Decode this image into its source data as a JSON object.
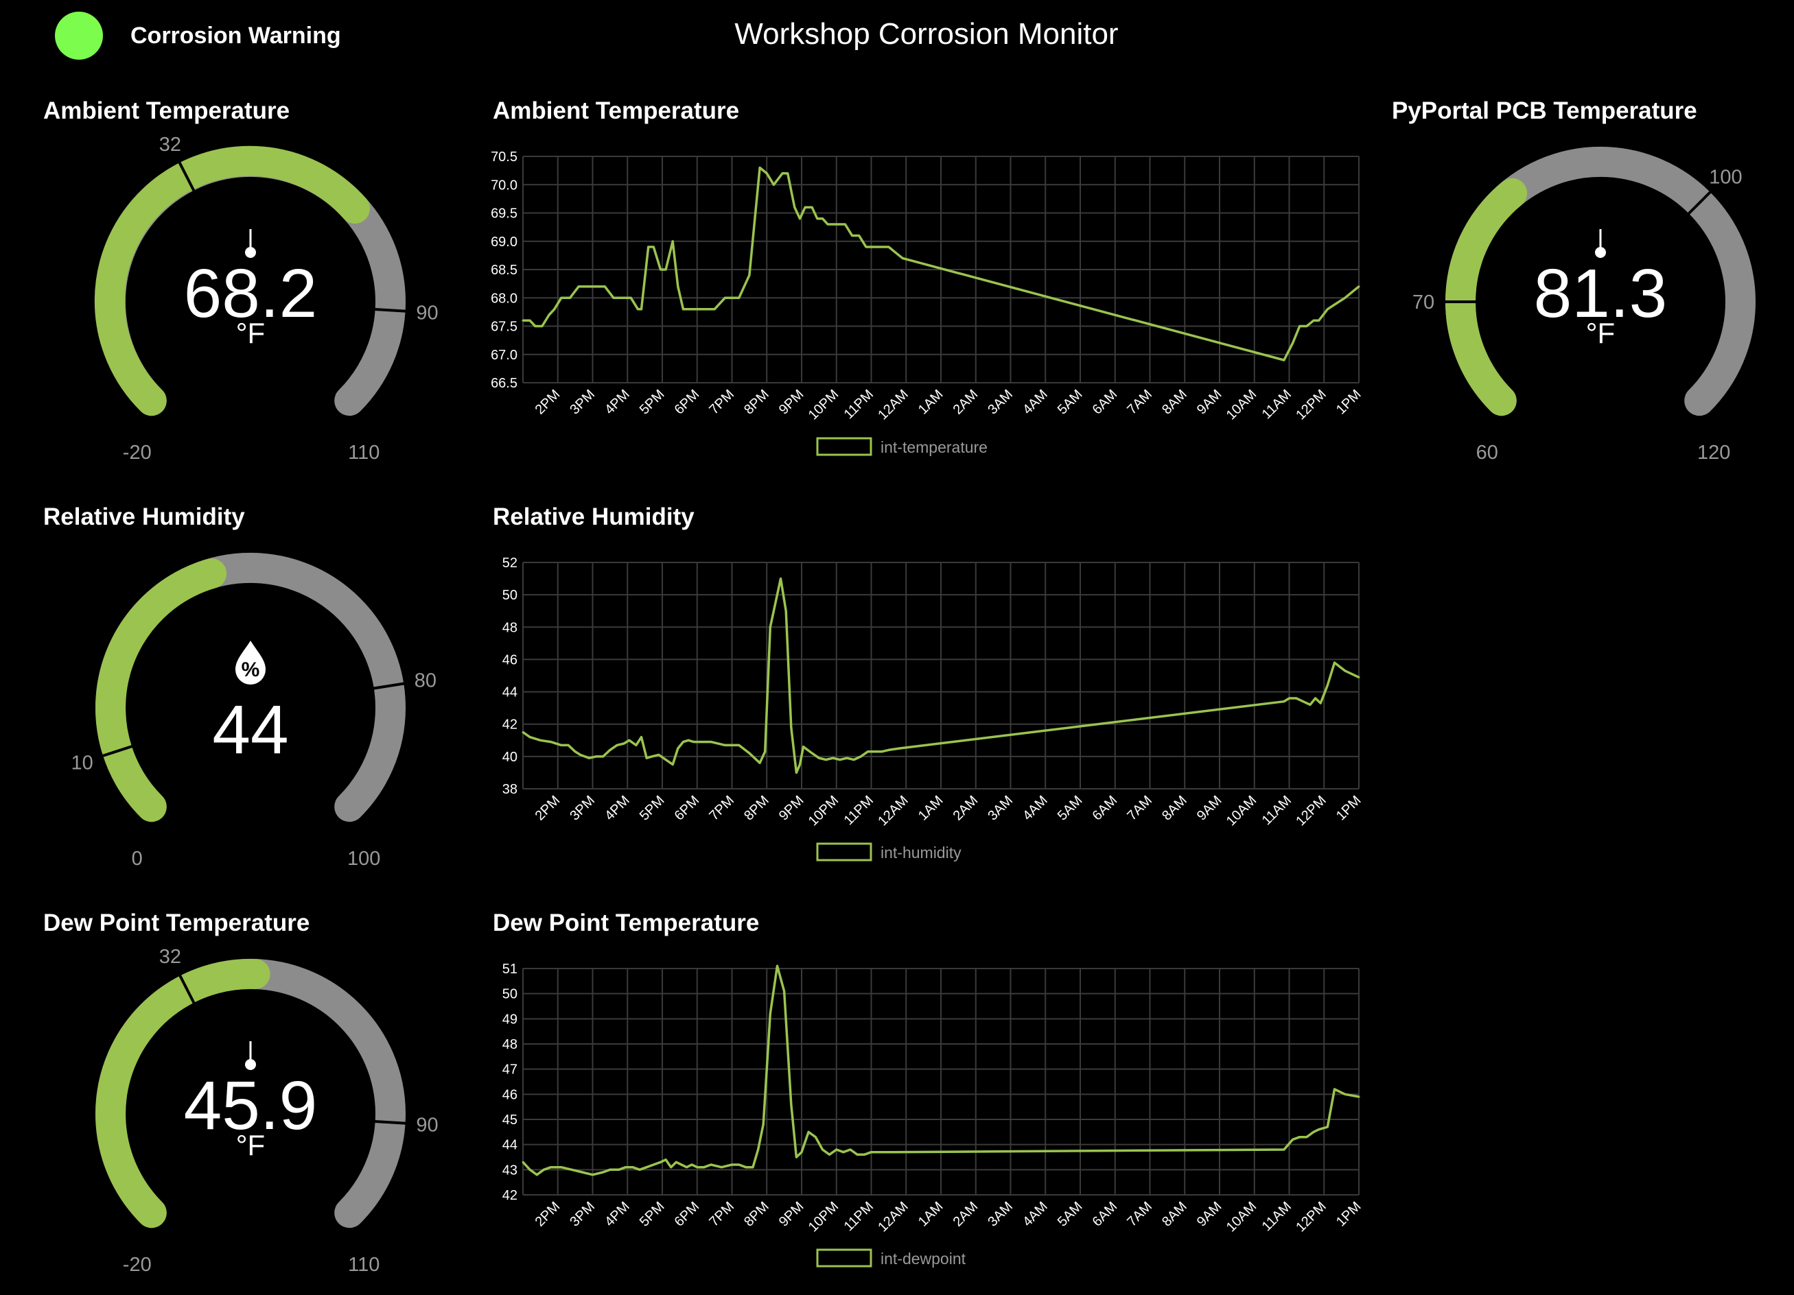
{
  "header": {
    "title": "Workshop Corrosion Monitor",
    "status_label": "Corrosion Warning",
    "status_color": "#7cfc4c"
  },
  "colors": {
    "accent": "#9bc34f",
    "track": "#8c8c8c",
    "grid": "#3a3a3a",
    "background": "#000000"
  },
  "gauges": [
    {
      "id": "ambient",
      "title": "Ambient Temperature",
      "value": "68.2",
      "unit": "°F",
      "icon": "thermometer-icon",
      "min": -20,
      "max": 110,
      "min_label": "-20",
      "max_label": "110",
      "thresholds": [
        {
          "value": 32,
          "label": "32"
        },
        {
          "value": 90,
          "label": "90"
        }
      ]
    },
    {
      "id": "pcb",
      "title": "PyPortal PCB Temperature",
      "value": "81.3",
      "unit": "°F",
      "icon": "thermometer-icon",
      "min": 60,
      "max": 120,
      "min_label": "60",
      "max_label": "120",
      "thresholds": [
        {
          "value": 70,
          "label": "70"
        },
        {
          "value": 100,
          "label": "100"
        }
      ]
    },
    {
      "id": "humidity",
      "title": "Relative Humidity",
      "value": "44",
      "unit": "",
      "icon": "humidity-drop-icon",
      "min": 0,
      "max": 100,
      "min_label": "0",
      "max_label": "100",
      "thresholds": [
        {
          "value": 10,
          "label": "10"
        },
        {
          "value": 80,
          "label": "80"
        }
      ]
    },
    {
      "id": "dewpoint",
      "title": "Dew Point Temperature",
      "value": "45.9",
      "unit": "°F",
      "icon": "thermometer-icon",
      "min": -20,
      "max": 110,
      "min_label": "-20",
      "max_label": "110",
      "thresholds": [
        {
          "value": 32,
          "label": "32"
        },
        {
          "value": 90,
          "label": "90"
        }
      ]
    }
  ],
  "charts": [
    {
      "title": "Ambient Temperature"
    },
    {
      "title": "Relative Humidity"
    },
    {
      "title": "Dew Point Temperature"
    }
  ],
  "chart_data": [
    {
      "type": "line",
      "title": "Ambient Temperature",
      "xlabel": "",
      "ylabel": "",
      "x_ticks": [
        "2PM",
        "3PM",
        "4PM",
        "5PM",
        "6PM",
        "7PM",
        "8PM",
        "9PM",
        "10PM",
        "11PM",
        "12AM",
        "1AM",
        "2AM",
        "3AM",
        "4AM",
        "5AM",
        "6AM",
        "7AM",
        "8AM",
        "9AM",
        "10AM",
        "11AM",
        "12PM",
        "1PM"
      ],
      "y_ticks": [
        "70.5",
        "70.0",
        "69.5",
        "69.0",
        "68.5",
        "68.0",
        "67.5",
        "67.0",
        "66.5"
      ],
      "ylim": [
        66.5,
        70.5
      ],
      "xlim_hours": [
        13,
        37
      ],
      "grid": true,
      "legend_position": "bottom",
      "series": [
        {
          "name": "int-temperature",
          "color": "#9bc34f",
          "x": [
            13.0,
            13.2,
            13.35,
            13.55,
            13.75,
            13.9,
            14.1,
            14.35,
            14.6,
            14.85,
            15.1,
            15.35,
            15.6,
            15.85,
            16.1,
            16.3,
            16.4,
            16.6,
            16.75,
            16.85,
            16.95,
            17.1,
            17.3,
            17.45,
            17.6,
            17.75,
            17.9,
            18.2,
            18.5,
            18.8,
            19.2,
            19.5,
            19.8,
            20.0,
            20.2,
            20.45,
            20.6,
            20.8,
            20.95,
            21.1,
            21.3,
            21.45,
            21.6,
            21.75,
            21.9,
            22.05,
            22.25,
            22.45,
            22.65,
            22.85,
            23.05,
            23.2,
            23.35,
            23.5,
            23.7,
            23.9,
            34.85,
            35.1,
            35.3,
            35.5,
            35.7,
            35.85,
            36.1,
            36.35,
            36.6,
            36.8,
            37.0
          ],
          "y": [
            67.6,
            67.6,
            67.5,
            67.5,
            67.7,
            67.8,
            68.0,
            68.0,
            68.2,
            68.2,
            68.2,
            68.2,
            68.0,
            68.0,
            68.0,
            67.8,
            67.8,
            68.9,
            68.9,
            68.7,
            68.5,
            68.5,
            69.0,
            68.2,
            67.8,
            67.8,
            67.8,
            67.8,
            67.8,
            68.0,
            68.0,
            68.4,
            70.3,
            70.2,
            70.0,
            70.2,
            70.2,
            69.6,
            69.4,
            69.6,
            69.6,
            69.4,
            69.4,
            69.3,
            69.3,
            69.3,
            69.3,
            69.1,
            69.1,
            68.9,
            68.9,
            68.9,
            68.9,
            68.9,
            68.8,
            68.7,
            66.9,
            67.2,
            67.5,
            67.5,
            67.6,
            67.6,
            67.8,
            67.9,
            68.0,
            68.1,
            68.2
          ]
        }
      ]
    },
    {
      "type": "line",
      "title": "Relative Humidity",
      "xlabel": "",
      "ylabel": "",
      "x_ticks": [
        "2PM",
        "3PM",
        "4PM",
        "5PM",
        "6PM",
        "7PM",
        "8PM",
        "9PM",
        "10PM",
        "11PM",
        "12AM",
        "1AM",
        "2AM",
        "3AM",
        "4AM",
        "5AM",
        "6AM",
        "7AM",
        "8AM",
        "9AM",
        "10AM",
        "11AM",
        "12PM",
        "1PM"
      ],
      "y_ticks": [
        "52",
        "50",
        "48",
        "46",
        "44",
        "42",
        "40",
        "38"
      ],
      "ylim": [
        38,
        52
      ],
      "xlim_hours": [
        13,
        37
      ],
      "grid": true,
      "legend_position": "bottom",
      "series": [
        {
          "name": "int-humidity",
          "color": "#9bc34f",
          "x": [
            13.0,
            13.2,
            13.5,
            13.8,
            14.1,
            14.3,
            14.5,
            14.65,
            14.9,
            15.1,
            15.3,
            15.5,
            15.7,
            15.9,
            16.05,
            16.25,
            16.4,
            16.55,
            16.7,
            16.9,
            17.1,
            17.3,
            17.45,
            17.6,
            17.75,
            17.9,
            18.1,
            18.4,
            18.8,
            19.2,
            19.5,
            19.8,
            19.95,
            20.1,
            20.4,
            20.55,
            20.7,
            20.85,
            20.95,
            21.05,
            21.3,
            21.5,
            21.7,
            21.9,
            22.1,
            22.3,
            22.5,
            22.7,
            22.9,
            23.1,
            23.3,
            23.5,
            23.8,
            34.85,
            35.0,
            35.2,
            35.4,
            35.6,
            35.75,
            35.9,
            36.1,
            36.3,
            36.6,
            37.0
          ],
          "y": [
            41.5,
            41.2,
            41.0,
            40.9,
            40.7,
            40.7,
            40.3,
            40.1,
            39.9,
            40.0,
            40.0,
            40.4,
            40.7,
            40.8,
            41.0,
            40.7,
            41.2,
            39.9,
            40.0,
            40.1,
            39.8,
            39.5,
            40.5,
            40.9,
            41.0,
            40.9,
            40.9,
            40.9,
            40.7,
            40.7,
            40.2,
            39.6,
            40.3,
            48.0,
            51.0,
            49.0,
            41.8,
            39.0,
            39.5,
            40.6,
            40.2,
            39.9,
            39.8,
            39.9,
            39.8,
            39.9,
            39.8,
            40.0,
            40.3,
            40.3,
            40.3,
            40.4,
            40.5,
            43.4,
            43.6,
            43.6,
            43.4,
            43.2,
            43.6,
            43.3,
            44.4,
            45.8,
            45.3,
            44.9
          ]
        }
      ]
    },
    {
      "type": "line",
      "title": "Dew Point Temperature",
      "xlabel": "",
      "ylabel": "",
      "x_ticks": [
        "2PM",
        "3PM",
        "4PM",
        "5PM",
        "6PM",
        "7PM",
        "8PM",
        "9PM",
        "10PM",
        "11PM",
        "12AM",
        "1AM",
        "2AM",
        "3AM",
        "4AM",
        "5AM",
        "6AM",
        "7AM",
        "8AM",
        "9AM",
        "10AM",
        "11AM",
        "12PM",
        "1PM"
      ],
      "y_ticks": [
        "51",
        "50",
        "49",
        "48",
        "47",
        "46",
        "45",
        "44",
        "43",
        "42"
      ],
      "ylim": [
        42,
        51
      ],
      "xlim_hours": [
        13,
        37
      ],
      "grid": true,
      "legend_position": "bottom",
      "series": [
        {
          "name": "int-dewpoint",
          "color": "#9bc34f",
          "x": [
            13.0,
            13.2,
            13.4,
            13.6,
            13.8,
            14.1,
            14.4,
            14.7,
            15.0,
            15.3,
            15.5,
            15.75,
            15.95,
            16.15,
            16.35,
            16.55,
            16.75,
            16.95,
            17.1,
            17.25,
            17.4,
            17.55,
            17.7,
            17.85,
            18.0,
            18.2,
            18.4,
            18.7,
            19.0,
            19.2,
            19.4,
            19.6,
            19.75,
            19.9,
            20.1,
            20.3,
            20.5,
            20.7,
            20.85,
            21.0,
            21.2,
            21.4,
            21.6,
            21.8,
            22.0,
            22.2,
            22.4,
            22.6,
            22.8,
            23.0,
            23.2,
            23.6,
            34.85,
            35.1,
            35.3,
            35.5,
            35.7,
            35.85,
            36.1,
            36.3,
            36.6,
            37.0
          ],
          "y": [
            43.3,
            43.0,
            42.8,
            43.0,
            43.1,
            43.1,
            43.0,
            42.9,
            42.8,
            42.9,
            43.0,
            43.0,
            43.1,
            43.1,
            43.0,
            43.1,
            43.2,
            43.3,
            43.4,
            43.1,
            43.3,
            43.2,
            43.1,
            43.2,
            43.1,
            43.1,
            43.2,
            43.1,
            43.2,
            43.2,
            43.1,
            43.1,
            43.8,
            44.8,
            49.2,
            51.1,
            50.1,
            45.6,
            43.5,
            43.7,
            44.5,
            44.3,
            43.8,
            43.6,
            43.8,
            43.7,
            43.8,
            43.6,
            43.6,
            43.7,
            43.7,
            43.7,
            43.8,
            44.2,
            44.3,
            44.3,
            44.5,
            44.6,
            44.7,
            46.2,
            46.0,
            45.9
          ]
        }
      ]
    }
  ]
}
